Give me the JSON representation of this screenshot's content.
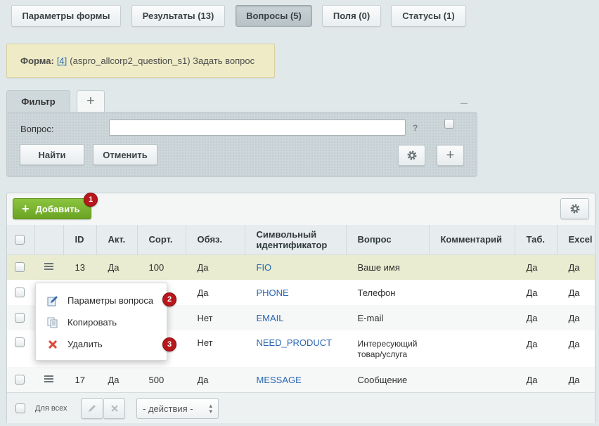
{
  "top_tabs": [
    {
      "label": "Параметры формы"
    },
    {
      "label": "Результаты (13)"
    },
    {
      "label": "Вопросы (5)"
    },
    {
      "label": "Поля (0)"
    },
    {
      "label": "Статусы (1)"
    }
  ],
  "info": {
    "label": "Форма:",
    "link": "[4]",
    "text": "(aspro_allcorp2_question_s1) Задать вопрос"
  },
  "filter": {
    "tab_label": "Фильтр",
    "add_tab": "+",
    "minimize": "–",
    "field_label": "Вопрос:",
    "field_value": "",
    "help": "?",
    "find_button": "Найти",
    "cancel_button": "Отменить",
    "plus": "+"
  },
  "grid": {
    "add_button": "Добавить",
    "add_badge": "1",
    "columns": [
      "ID",
      "Акт.",
      "Сорт.",
      "Обяз.",
      "Символьный идентификатор",
      "Вопрос",
      "Комментарий",
      "Таб.",
      "Excel"
    ],
    "rows": [
      {
        "id": "13",
        "active": "Да",
        "sort": "100",
        "required": "Да",
        "code": "FIO",
        "question": "Ваше имя",
        "comment": "",
        "tab": "Да",
        "excel": "Да"
      },
      {
        "id": "",
        "active": "",
        "sort": "",
        "required": "Да",
        "code": "PHONE",
        "question": "Телефон",
        "comment": "",
        "tab": "Да",
        "excel": "Да"
      },
      {
        "id": "",
        "active": "",
        "sort": "",
        "required": "Нет",
        "code": "EMAIL",
        "question": "E-mail",
        "comment": "",
        "tab": "Да",
        "excel": "Да"
      },
      {
        "id": "",
        "active": "",
        "sort": "",
        "required": "Нет",
        "code": "NEED_PRODUCT",
        "question": "Интересующий товар/услуга",
        "comment": "",
        "tab": "Да",
        "excel": "Да"
      },
      {
        "id": "17",
        "active": "Да",
        "sort": "500",
        "required": "Да",
        "code": "MESSAGE",
        "question": "Сообщение",
        "comment": "",
        "tab": "Да",
        "excel": "Да"
      }
    ]
  },
  "context_menu": {
    "items": [
      {
        "label": "Параметры вопроса",
        "badge": "2",
        "icon": "edit-icon"
      },
      {
        "label": "Копировать",
        "badge": "",
        "icon": "copy-icon"
      },
      {
        "label": "Удалить",
        "badge": "3",
        "icon": "delete-icon"
      }
    ]
  },
  "footer": {
    "all_label": "Для всех",
    "actions_select": "- действия -"
  },
  "colors": {
    "page_bg": "#e1e8ea",
    "add_button": "#7bb531",
    "badge": "#b7181c",
    "link": "#2a67b1",
    "selected_row": "#e9ecd0",
    "info_bg": "#eeebc6"
  }
}
